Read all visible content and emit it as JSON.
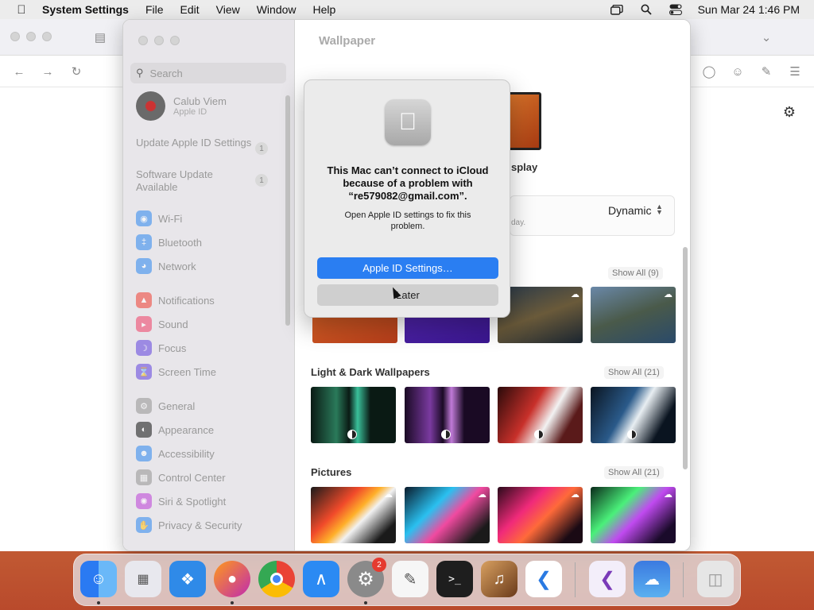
{
  "menubar": {
    "app": "System Settings",
    "items": [
      "File",
      "Edit",
      "View",
      "Window",
      "Help"
    ],
    "datetime": "Sun Mar 24  1:46 PM"
  },
  "sidebar": {
    "search_placeholder": "Search",
    "account": {
      "name": "Calub Viem",
      "sub": "Apple ID"
    },
    "updates": [
      {
        "label": "Update Apple ID Settings",
        "count": "1"
      },
      {
        "label": "Software Update Available",
        "count": "1"
      }
    ],
    "items": [
      {
        "label": "Wi-Fi",
        "icon": "wifi-icon",
        "color": "#3b8ef0"
      },
      {
        "label": "Bluetooth",
        "icon": "bluetooth-icon",
        "color": "#3b8ef0"
      },
      {
        "label": "Network",
        "icon": "globe-icon",
        "color": "#3b8ef0"
      },
      {
        "label": "Notifications",
        "icon": "bell-icon",
        "color": "#ef4a3f"
      },
      {
        "label": "Sound",
        "icon": "speaker-icon",
        "color": "#ef4a6f"
      },
      {
        "label": "Focus",
        "icon": "moon-icon",
        "color": "#6a4ee0"
      },
      {
        "label": "Screen Time",
        "icon": "hourglass-icon",
        "color": "#6a4ee0"
      },
      {
        "label": "General",
        "icon": "gear-icon",
        "color": "#9a9a9a"
      },
      {
        "label": "Appearance",
        "icon": "appearance-icon",
        "color": "#222222"
      },
      {
        "label": "Accessibility",
        "icon": "accessibility-icon",
        "color": "#3b8ef0"
      },
      {
        "label": "Control Center",
        "icon": "control-center-icon",
        "color": "#9a9a9a"
      },
      {
        "label": "Siri & Spotlight",
        "icon": "siri-icon",
        "color": "#c04ad8"
      },
      {
        "label": "Privacy & Security",
        "icon": "hand-icon",
        "color": "#3b8ef0"
      }
    ]
  },
  "main": {
    "title": "Wallpaper",
    "display_label": "splay",
    "dynamic_note": "day.",
    "dynamic_value": "Dynamic",
    "sections": [
      {
        "title": "",
        "show_all": "Show All (9)"
      },
      {
        "title": "Light & Dark Wallpapers",
        "show_all": "Show All (21)"
      },
      {
        "title": "Pictures",
        "show_all": "Show All (21)"
      }
    ]
  },
  "dialog": {
    "title": "This Mac can’t connect to iCloud because of a problem with “re579082@gmail.com”.",
    "message": "Open Apple ID settings to fix this problem.",
    "primary_button": "Apple ID Settings…",
    "secondary_button": "Later"
  },
  "dock": {
    "apps": [
      {
        "name": "Finder",
        "color": "#3a8ef5"
      },
      {
        "name": "Launchpad",
        "color": "#e8e8ee"
      },
      {
        "name": "Safari",
        "color": "#2f8ae8"
      },
      {
        "name": "Firefox",
        "color": "#ff6a1a"
      },
      {
        "name": "Chrome",
        "color": "#f4f4f4"
      },
      {
        "name": "App Store",
        "color": "#2b8af3"
      },
      {
        "name": "System Settings",
        "color": "#8a8a8a"
      },
      {
        "name": "TextEdit",
        "color": "#f6f6f6"
      },
      {
        "name": "Terminal",
        "color": "#1e1e1e"
      },
      {
        "name": "Instruments",
        "color": "#c8a060"
      },
      {
        "name": "Visual Studio Code",
        "color": "#ffffff"
      },
      {
        "name": "Visual Studio",
        "color": "#f3eefa"
      },
      {
        "name": "Weather",
        "color": "#3b8fe0"
      },
      {
        "name": "Trash",
        "color": "#e6e6e6"
      }
    ],
    "badge": "2"
  }
}
